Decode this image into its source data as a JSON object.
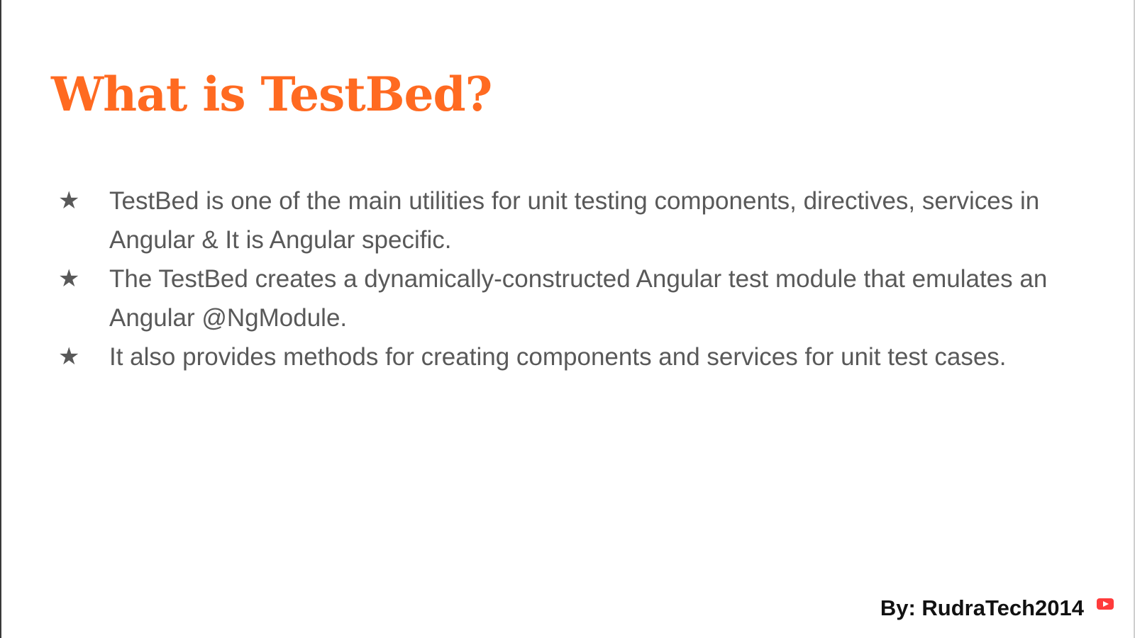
{
  "slide": {
    "title": "What is TestBed?",
    "bullets": [
      {
        "text": "TestBed is one of the main utilities for unit testing components, directives, services in Angular & It is Angular specific."
      },
      {
        "text": "The  TestBed creates a dynamically-constructed Angular test module that emulates an Angular @NgModule."
      },
      {
        "text": "It also provides methods for creating components and services for unit test cases."
      }
    ],
    "bullet_symbol": "★",
    "footer": "By: RudraTech2014"
  },
  "colors": {
    "title": "#ff6a21",
    "body_text": "#595959",
    "footer_text": "#111111",
    "youtube_icon": "#ff3b3b"
  },
  "icons": {
    "bullet": "star-icon",
    "channel": "youtube-icon"
  }
}
